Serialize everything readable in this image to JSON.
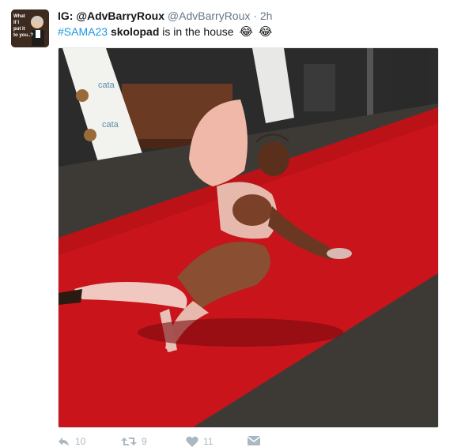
{
  "tweet": {
    "display_name": "IG: @AdvBarryRoux",
    "handle": "@AdvBarryRoux",
    "separator": "·",
    "time": "2h",
    "text": {
      "hashtag": "#SAMA23",
      "bold_word": "skolopad",
      "rest": " is in the house",
      "emoji1": "😂",
      "emoji2": "😂"
    },
    "avatar": {
      "caption_lines": [
        "What",
        "if I",
        "put it",
        "to you..?"
      ]
    },
    "media": {
      "banner_brand": "cata",
      "icon": "photo"
    },
    "actions": {
      "reply_count": "10",
      "retweet_count": "9",
      "like_count": "11"
    }
  },
  "colors": {
    "link": "#1b95e0",
    "muted": "#657786",
    "action": "#aab8c2",
    "carpet": "#c8141a"
  }
}
